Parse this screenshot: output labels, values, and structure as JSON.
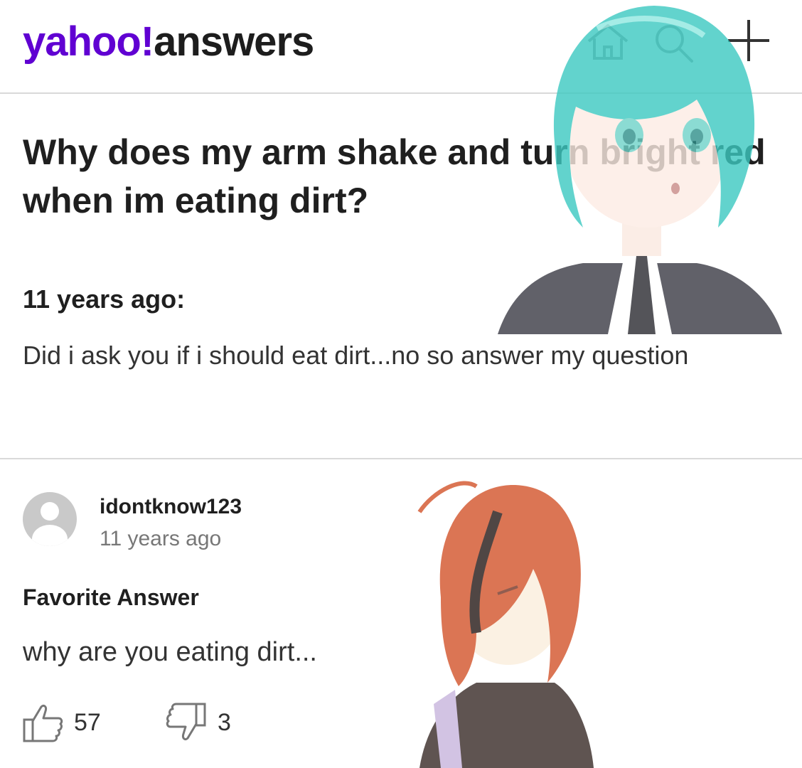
{
  "header": {
    "logo_brand": "yahoo!",
    "logo_product": "answers",
    "icons": [
      "home-icon",
      "search-icon",
      "plus-icon"
    ]
  },
  "question": {
    "title": "Why does my arm shake and turn bright red when im eating dirt?",
    "asked_label": "11 years ago:",
    "details": "Did i ask you if i should eat dirt...no so answer my question"
  },
  "answer": {
    "username": "idontknow123",
    "time": "11 years ago",
    "favorite_label": "Favorite Answer",
    "text": "why are you eating dirt...",
    "upvotes": "57",
    "downvotes": "3"
  },
  "colors": {
    "brand": "#6001d2",
    "divider": "#d9d9d9",
    "avatar": "#c9c9c9"
  }
}
